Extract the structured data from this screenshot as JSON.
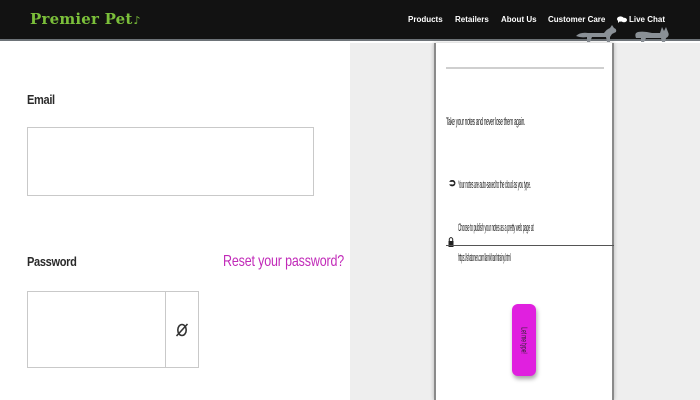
{
  "header": {
    "logo_text": "Premier Pet",
    "logo_mark": "♪",
    "nav": [
      {
        "label": "Products"
      },
      {
        "label": "Retailers"
      },
      {
        "label": "About Us"
      },
      {
        "label": "Customer Care"
      },
      {
        "label": "Live Chat",
        "icon": "chat-bubbles-icon"
      }
    ],
    "background": "#121212",
    "logo_color": "#7bbf3a"
  },
  "form": {
    "email_label": "Email",
    "email_value": "",
    "password_label": "Password",
    "password_value": "",
    "reset_link": "Reset your password?",
    "reset_color": "#c12ab8",
    "toggle_icon": "eye-slash-icon"
  },
  "modal": {
    "lines": [
      "Take your notes and never lose them again.",
      "Your notes are auto-saved to the cloud as you type.",
      "Choose to publish your notes as a pretty web page at",
      "https://shatoner.com/lamkhanhtrainy.html"
    ],
    "step_icons": [
      "arrow-step-icon",
      "arrow-step-icon",
      "lock-step-icon"
    ],
    "button_label": "Let me type!",
    "button_color": "#e020df"
  }
}
